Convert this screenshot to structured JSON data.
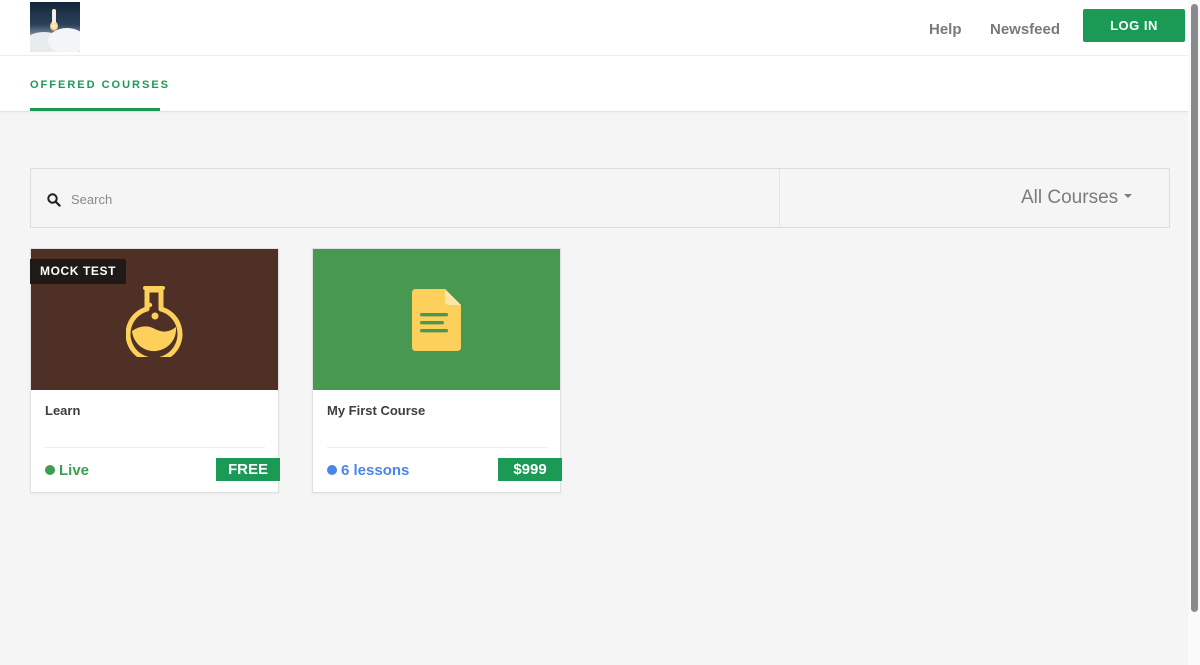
{
  "header": {
    "logo_name": "rocket-launch-logo",
    "nav": [
      {
        "label": "Help"
      },
      {
        "label": "Newsfeed"
      }
    ],
    "login_label": "LOG IN"
  },
  "tabs": {
    "active": "OFFERED COURSES"
  },
  "search": {
    "placeholder": "Search",
    "value": "",
    "filter_label": "All Courses"
  },
  "courses": [
    {
      "badge": "MOCK TEST",
      "title": "Learn",
      "status": "Live",
      "price": "FREE",
      "icon": "flask-icon",
      "thumb_color": "#4e3026"
    },
    {
      "badge": "",
      "title": "My First Course",
      "status": "6 lessons",
      "price": "$999",
      "icon": "document-icon",
      "thumb_color": "#489851"
    }
  ],
  "colors": {
    "brand": "#1b9a56",
    "live": "#3e9e4f",
    "lessons": "#4a86e8",
    "icon_yellow": "#fdd05c"
  }
}
